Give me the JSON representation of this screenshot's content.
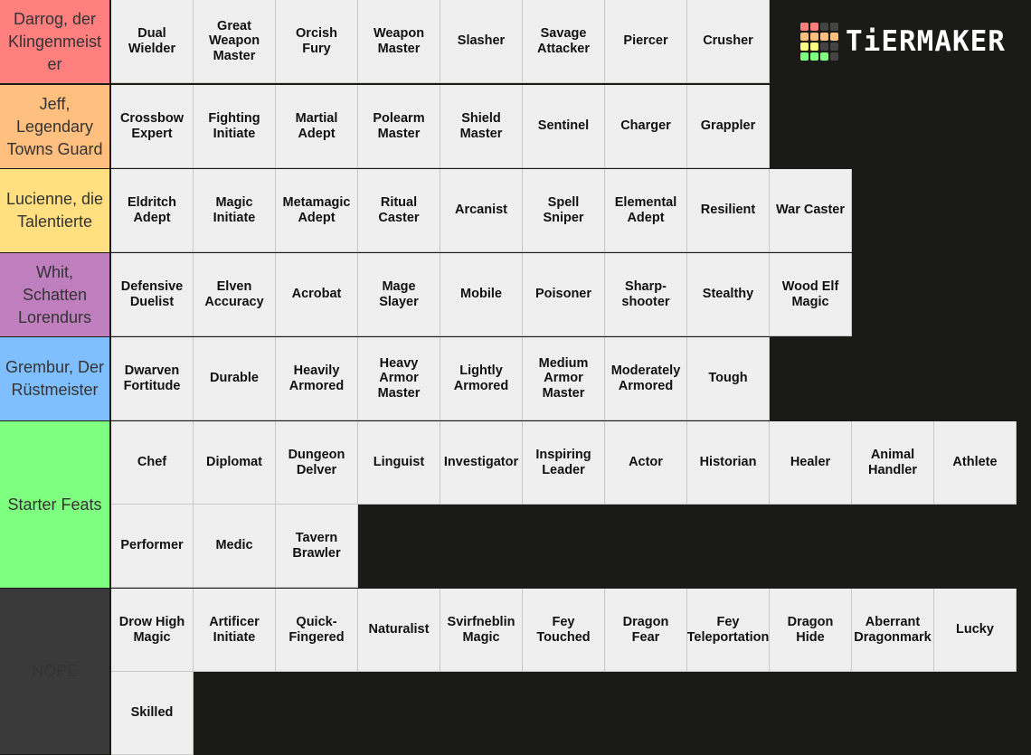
{
  "logo": {
    "text": "TiERMAKER",
    "grid_colors": [
      "#ff7f7f",
      "#ff7f7f",
      "#444444",
      "#444444",
      "#ffbf7f",
      "#ffbf7f",
      "#ffbf7f",
      "#ffbf7f",
      "#ffff7f",
      "#ffff7f",
      "#444444",
      "#444444",
      "#7fff7f",
      "#7fff7f",
      "#7fff7f",
      "#444444"
    ]
  },
  "tiers": [
    {
      "label": "Darrog, der Klingenmeist er",
      "color": "#ff7f7f",
      "items": [
        "Dual\nWielder",
        "Great\nWeapon\nMaster",
        "Orcish\nFury",
        "Weapon\nMaster",
        "Slasher",
        "Savage\nAttacker",
        "Piercer",
        "Crusher"
      ]
    },
    {
      "label": "Jeff, Legendary Towns Guard",
      "color": "#ffbf7f",
      "items": [
        "Crossbow\nExpert",
        "Fighting\nInitiate",
        "Martial\nAdept",
        "Polearm\nMaster",
        "Shield\nMaster",
        "Sentinel",
        "Charger",
        "Grappler"
      ]
    },
    {
      "label": "Lucienne, die Talentierte",
      "color": "#ffdf7f",
      "items": [
        "Eldritch\nAdept",
        "Magic\nInitiate",
        "Metamagic\nAdept",
        "Ritual\nCaster",
        "Arcanist",
        "Spell\nSniper",
        "Elemental\nAdept",
        "Resilient",
        "War Caster"
      ]
    },
    {
      "label": "Whit, Schatten Lorendurs",
      "color": "#bf7fbf",
      "items": [
        "Defensive\nDuelist",
        "Elven\nAccuracy",
        "Acrobat",
        "Mage\nSlayer",
        "Mobile",
        "Poisoner",
        "Sharp-\nshooter",
        "Stealthy",
        "Wood Elf\nMagic"
      ]
    },
    {
      "label": "Grembur, Der Rüstmeister",
      "color": "#7fbfff",
      "items": [
        "Dwarven\nFortitude",
        "Durable",
        "Heavily\nArmored",
        "Heavy\nArmor\nMaster",
        "Lightly\nArmored",
        "Medium\nArmor\nMaster",
        "Moderately\nArmored",
        "Tough"
      ]
    },
    {
      "label": "Starter Feats",
      "color": "#7fff7f",
      "items": [
        "Chef",
        "Diplomat",
        "Dungeon\nDelver",
        "Linguist",
        "Investigator",
        "Inspiring\nLeader",
        "Actor",
        "Historian",
        "Healer",
        "Animal\nHandler",
        "Athlete",
        "Performer",
        "Medic",
        "Tavern\nBrawler"
      ]
    },
    {
      "label": "NOPE",
      "color": "#3a3a3a",
      "label_text_color": "#333333",
      "items": [
        "Drow High\nMagic",
        "Artificer\nInitiate",
        "Quick-\nFingered",
        "Naturalist",
        "Svirfneblin\nMagic",
        "Fey\nTouched",
        "Dragon\nFear",
        "Fey\nTeleportation",
        "Dragon\nHide",
        "Aberrant\nDragonmark",
        "Lucky",
        "Skilled"
      ]
    }
  ]
}
